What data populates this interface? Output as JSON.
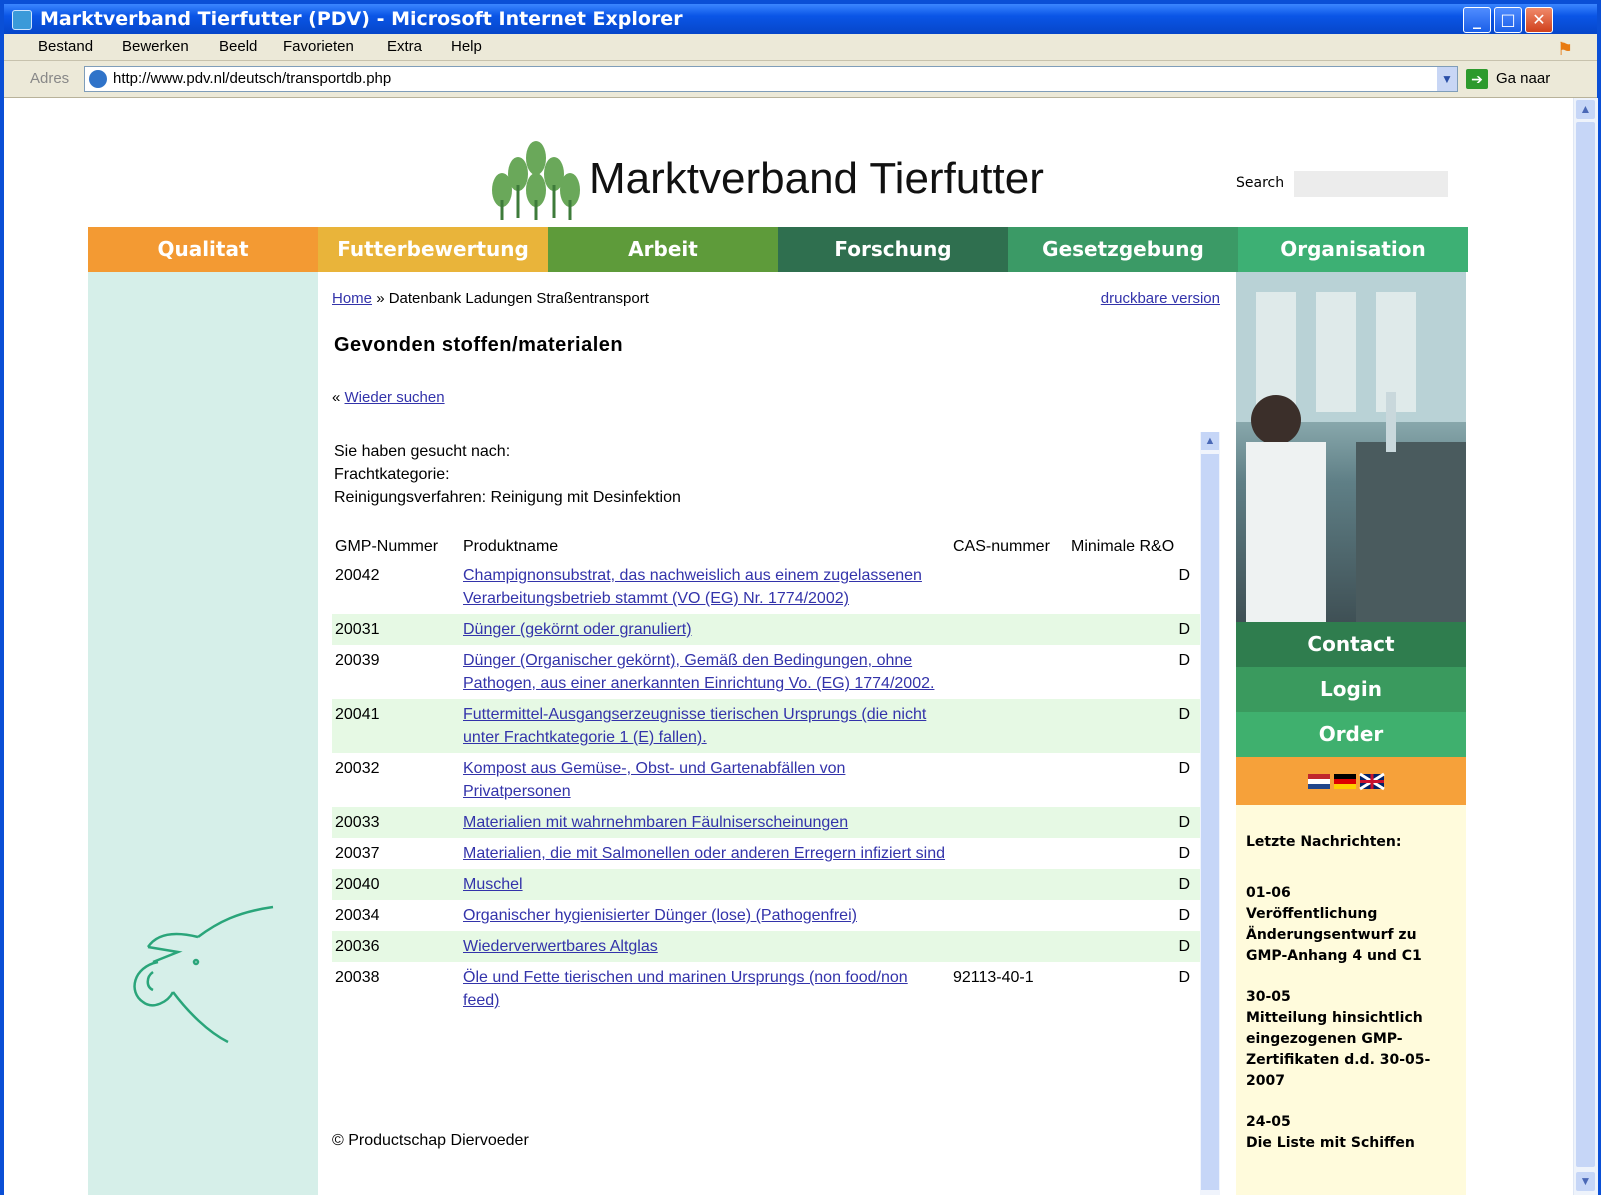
{
  "browser": {
    "title": "Marktverband Tierfutter (PDV) - Microsoft Internet Explorer",
    "menu": [
      "Bestand",
      "Bewerken",
      "Beeld",
      "Favorieten",
      "Extra",
      "Help"
    ],
    "address_label": "Adres",
    "url": "http://www.pdv.nl/deutsch/transportdb.php",
    "go_label": "Ga naar"
  },
  "site": {
    "title": "Marktverband Tierfutter",
    "search_label": "Search",
    "nav": [
      {
        "label": "Qualitat",
        "color": "#f39a33"
      },
      {
        "label": "Futterbewertung",
        "color": "#e9b43a"
      },
      {
        "label": "Arbeit",
        "color": "#5e9b3a"
      },
      {
        "label": "Forschung",
        "color": "#2f6f4f"
      },
      {
        "label": "Gesetzgebung",
        "color": "#3b9a66"
      },
      {
        "label": "Organisation",
        "color": "#3db074"
      }
    ]
  },
  "breadcrumb": {
    "home": "Home",
    "separator": "»",
    "current": "Datenbank Ladungen Straßentransport"
  },
  "print_label": "druckbare version",
  "page_title": "Gevonden stoffen/materialen",
  "back_link": {
    "arrow": "«",
    "label": "Wieder suchen"
  },
  "query": {
    "line1": "Sie haben gesucht nach:",
    "line2": "Frachtkategorie:",
    "line3": "Reinigungsverfahren: Reinigung mit Desinfektion"
  },
  "table": {
    "headers": [
      "GMP-Nummer",
      "Produktname",
      "CAS-nummer",
      "Minimale R&O"
    ],
    "rows": [
      {
        "gmp": "20042",
        "name": "Champignonsubstrat, das nachweislich aus einem zugelassenen Verarbeitungsbetrieb stammt (VO (EG) Nr. 1774/2002)",
        "cas": "",
        "ro": "D"
      },
      {
        "gmp": "20031",
        "name": "Dünger (gekörnt oder granuliert)",
        "cas": "",
        "ro": "D"
      },
      {
        "gmp": "20039",
        "name": "Dünger (Organischer gekörnt), Gemäß den Bedingungen, ohne Pathogen, aus einer anerkannten Einrichtung Vo. (EG) 1774/2002.",
        "cas": "",
        "ro": "D"
      },
      {
        "gmp": "20041",
        "name": "Futtermittel-Ausgangserzeugnisse tierischen Ursprungs (die nicht unter Frachtkategorie 1 (E) fallen).",
        "cas": "",
        "ro": "D"
      },
      {
        "gmp": "20032",
        "name": "Kompost aus Gemüse-, Obst- und Gartenabfällen von Privatpersonen",
        "cas": "",
        "ro": "D"
      },
      {
        "gmp": "20033",
        "name": "Materialien mit wahrnehmbaren Fäulniserscheinungen",
        "cas": "",
        "ro": "D"
      },
      {
        "gmp": "20037",
        "name": "Materialien, die mit Salmonellen oder anderen Erregern infiziert sind",
        "cas": "",
        "ro": "D"
      },
      {
        "gmp": "20040",
        "name": "Muschel",
        "cas": "",
        "ro": "D"
      },
      {
        "gmp": "20034",
        "name": "Organischer hygienisierter Dünger (lose) (Pathogenfrei)",
        "cas": "",
        "ro": "D"
      },
      {
        "gmp": "20036",
        "name": "Wiederverwertbares Altglas",
        "cas": "",
        "ro": "D"
      },
      {
        "gmp": "20038",
        "name": "Öle und Fette tierischen und marinen Ursprungs (non food/non feed)",
        "cas": "92113-40-1",
        "ro": "D"
      }
    ]
  },
  "footer": "© Productschap Diervoeder",
  "sidebar": {
    "buttons": [
      {
        "label": "Contact",
        "color": "#2f7d4e"
      },
      {
        "label": "Login",
        "color": "#3a9a5e"
      },
      {
        "label": "Order",
        "color": "#3fb06e"
      }
    ],
    "news_title": "Letzte Nachrichten:",
    "news": [
      {
        "date": "01-06",
        "text": "Veröffentlichung Änderungsentwurf zu GMP-Anhang 4 und C1"
      },
      {
        "date": "30-05",
        "text": "Mitteilung hinsichtlich eingezogenen GMP-Zertifikaten d.d. 30-05-2007"
      },
      {
        "date": "24-05",
        "text": "Die Liste mit Schiffen"
      }
    ]
  }
}
